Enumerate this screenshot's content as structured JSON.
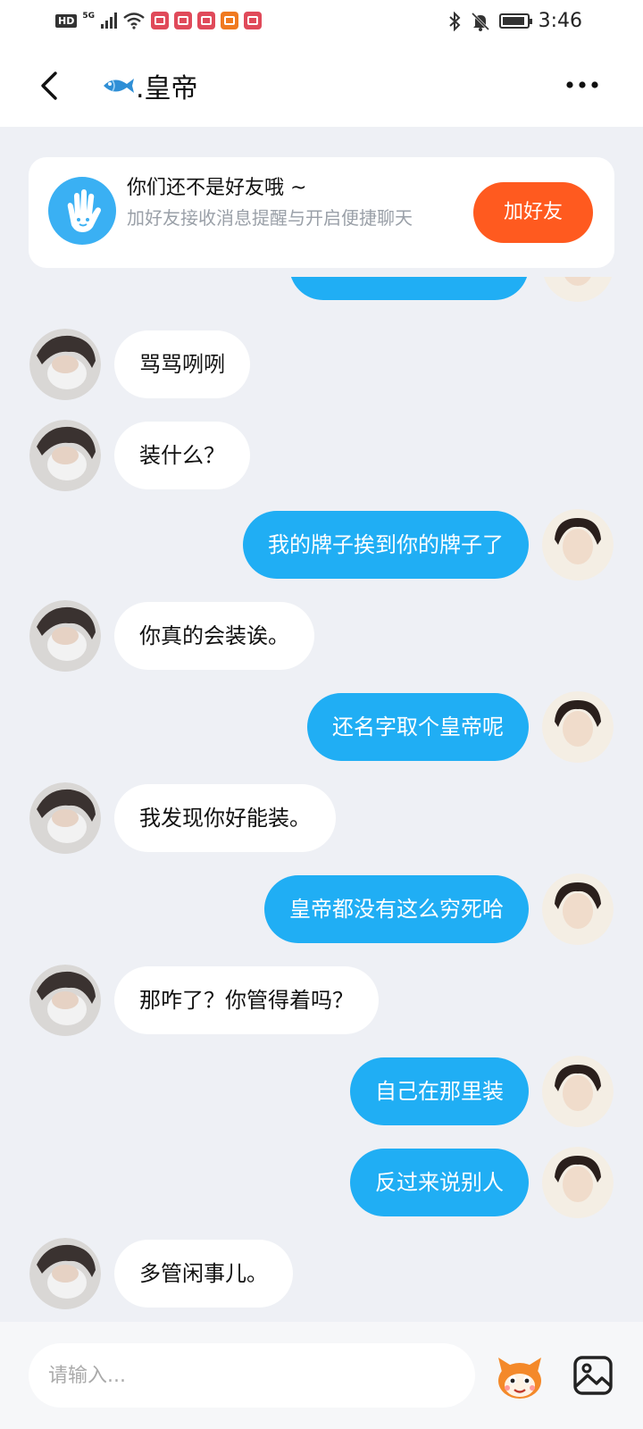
{
  "status_bar": {
    "hd": "HD",
    "network": "5G",
    "time": "3:46"
  },
  "header": {
    "title": ".皇帝",
    "back_icon": "chevron-left-icon",
    "more_icon": "more-dots-icon"
  },
  "friend_banner": {
    "title": "你们还不是好友哦 ~",
    "subtitle": "加好友接收消息提醒与开启便捷聊天",
    "button_label": "加好友"
  },
  "messages": [
    {
      "side": "out",
      "text": ""
    },
    {
      "side": "in",
      "text": "骂骂咧咧"
    },
    {
      "side": "in",
      "text": "装什么？"
    },
    {
      "side": "out",
      "text": "我的牌子挨到你的牌子了"
    },
    {
      "side": "in",
      "text": "你真的会装诶。"
    },
    {
      "side": "out",
      "text": "还名字取个皇帝呢"
    },
    {
      "side": "in",
      "text": "我发现你好能装。"
    },
    {
      "side": "out",
      "text": "皇帝都没有这么穷死哈"
    },
    {
      "side": "in",
      "text": "那咋了？你管得着吗？"
    },
    {
      "side": "out",
      "text": "自己在那里装"
    },
    {
      "side": "out",
      "text": "反过来说别人"
    },
    {
      "side": "in",
      "text": "多管闲事儿。"
    }
  ],
  "input_bar": {
    "placeholder": "请输入...",
    "emoji_icon": "emoji-mascot-icon",
    "image_icon": "image-icon"
  },
  "colors": {
    "outgoing_bubble": "#20aef4",
    "incoming_bubble": "#ffffff",
    "background": "#eef0f5",
    "add_friend_button": "#ff5a1f"
  }
}
